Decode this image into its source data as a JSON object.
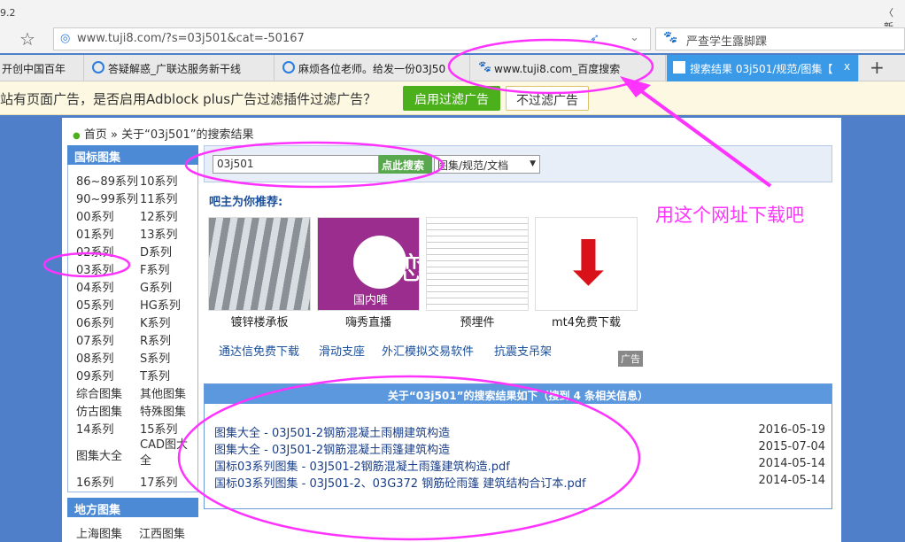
{
  "browser": {
    "version_fragment": "9.2",
    "right_fragment": "〈 新",
    "url": "www.tuji8.com/?s=03j501&cat=-50167",
    "search_text": "严查学生露脚踝",
    "tabs": [
      {
        "label": "开创中国百年"
      },
      {
        "label": "答疑解惑_广联达服务新干线"
      },
      {
        "label": "麻烦各位老师。给发一份03J50"
      },
      {
        "label": "www.tuji8.com_百度搜索"
      },
      {
        "label": "搜索结果 03j501/规范/图集【",
        "active": true
      }
    ],
    "new_tab": "+",
    "close_tab": "x"
  },
  "adblock": {
    "message": "站有页面广告，是否启用Adblock plus广告过滤插件过滤广告？",
    "enable": "启用过滤广告",
    "disable": "不过滤广告"
  },
  "breadcrumb": {
    "home": "首页",
    "rest": " » 关于“03j501”的搜索结果"
  },
  "sidebar": {
    "title": "国标图集",
    "items": [
      [
        "86~89系列",
        "10系列"
      ],
      [
        "90~99系列",
        "11系列"
      ],
      [
        "00系列",
        "12系列"
      ],
      [
        "01系列",
        "13系列"
      ],
      [
        "02系列",
        "D系列"
      ],
      [
        "03系列",
        "F系列"
      ],
      [
        "04系列",
        "G系列"
      ],
      [
        "05系列",
        "HG系列"
      ],
      [
        "06系列",
        "K系列"
      ],
      [
        "07系列",
        "R系列"
      ],
      [
        "08系列",
        "S系列"
      ],
      [
        "09系列",
        "T系列"
      ],
      [
        "综合图集",
        "其他图集"
      ],
      [
        "仿古图集",
        "特殊图集"
      ],
      [
        "14系列",
        "15系列"
      ],
      [
        "图集大全",
        "CAD图大全"
      ],
      [
        "16系列",
        "17系列"
      ]
    ],
    "title2": "地方图集",
    "items2": [
      "上海图集",
      "江西图集"
    ]
  },
  "search": {
    "value": "03j501",
    "button": "点此搜索",
    "category": "图集/规范/文档"
  },
  "recommend": {
    "title": "吧主为你推荐:",
    "items": [
      "镀锌楼承板",
      "嗨秀直播",
      "预埋件",
      "mt4免费下载"
    ],
    "thumb_text": "恋",
    "thumb_sub": "国内唯"
  },
  "ads": {
    "links": [
      "通达信免费下载",
      "滑动支座",
      "外汇模拟交易软件",
      "抗震支吊架"
    ],
    "badge": "广告"
  },
  "results": {
    "header": "关于“03j501”的搜索结果如下（搜到 4 条相关信息）",
    "rows": [
      {
        "title": "图集大全 - 03J501-2钢筋混凝土雨棚建筑构造",
        "date": "2016-05-19"
      },
      {
        "title": "图集大全 - 03J501-2钢筋混凝土雨篷建筑构造",
        "date": "2015-07-04"
      },
      {
        "title": "国标03系列图集 - 03J501-2钢筋混凝土雨篷建筑构造.pdf",
        "date": "2014-05-14"
      },
      {
        "title": "国标03系列图集 - 03J501-2、03G372 钢筋砼雨篷 建筑结构合订本.pdf",
        "date": "2014-05-14"
      }
    ]
  },
  "annotation": {
    "text": "用这个网址下载吧",
    "color": "#ff33ff"
  }
}
